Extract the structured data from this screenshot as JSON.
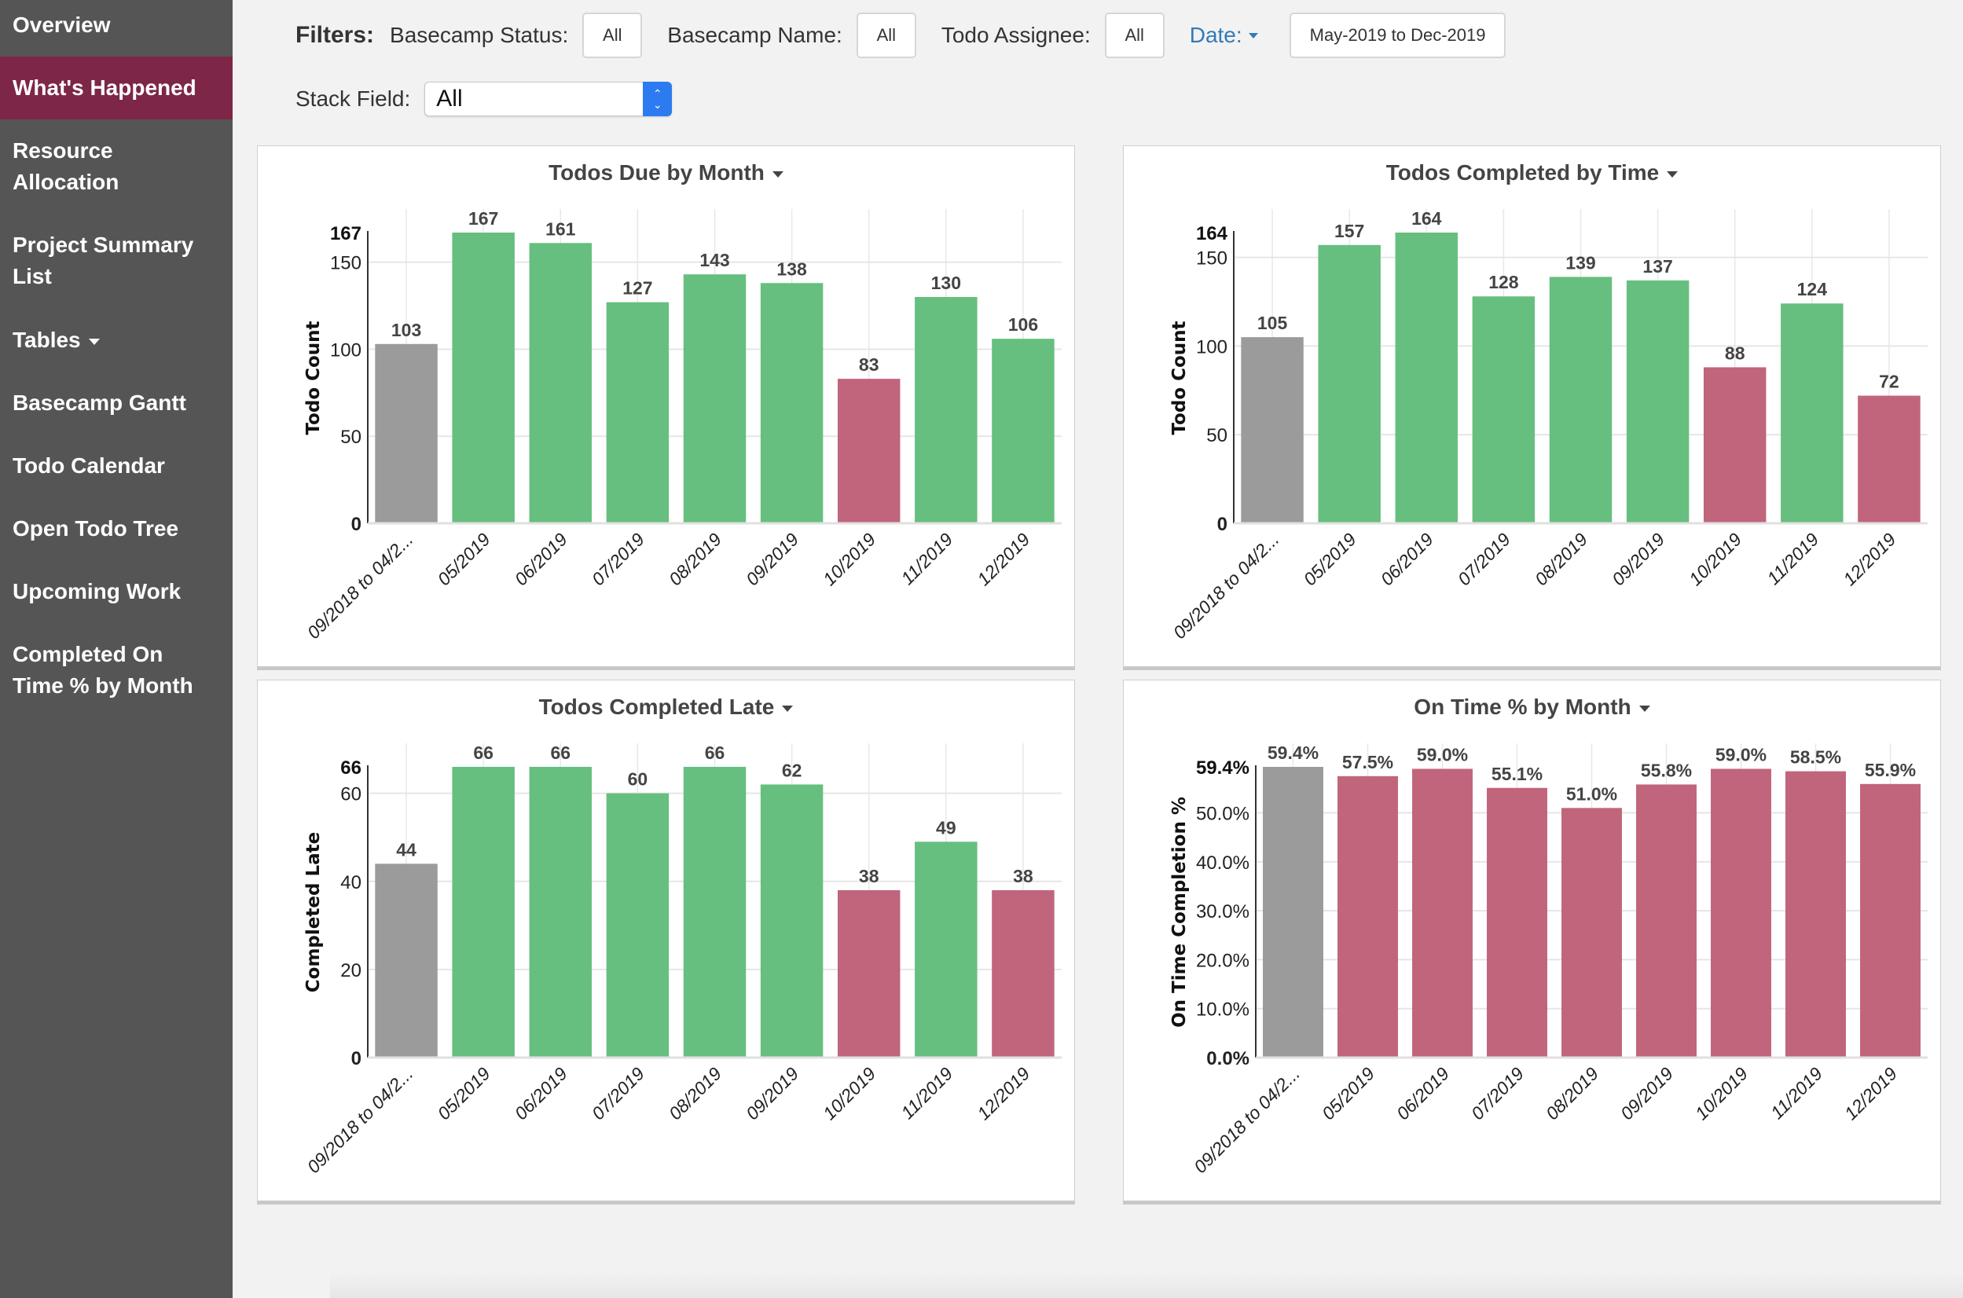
{
  "sidebar": {
    "items": [
      {
        "label": "Overview",
        "active": false
      },
      {
        "label": "What's Happened",
        "active": true
      },
      {
        "label": "Resource\nAllocation",
        "active": false
      },
      {
        "label": "Project Summary\nList",
        "active": false
      },
      {
        "label": "Tables",
        "active": false,
        "dropdown": true
      },
      {
        "label": "Basecamp Gantt",
        "active": false
      },
      {
        "label": "Todo Calendar",
        "active": false
      },
      {
        "label": "Open Todo Tree",
        "active": false
      },
      {
        "label": "Upcoming Work",
        "active": false
      },
      {
        "label": "Completed On\nTime % by Month",
        "active": false
      }
    ]
  },
  "filters": {
    "title": "Filters:",
    "basecamp_status_label": "Basecamp Status:",
    "basecamp_status_value": "All",
    "basecamp_name_label": "Basecamp Name:",
    "basecamp_name_value": "All",
    "todo_assignee_label": "Todo Assignee:",
    "todo_assignee_value": "All",
    "date_label": "Date:",
    "date_value": "May-2019 to Dec-2019",
    "stack_field_label": "Stack Field:",
    "stack_field_value": "All"
  },
  "colors": {
    "sidebar_bg": "#555555",
    "active_nav": "#7d2647",
    "green": "#66bf7f",
    "red": "#c0657c",
    "gray": "#9b9b9b",
    "link": "#337ab7"
  },
  "chart_data": [
    {
      "type": "bar",
      "title": "Todos Due by Month",
      "xlabel": "",
      "ylabel": "Todo Count",
      "categories": [
        "09/2018 to 04/2...",
        "05/2019",
        "06/2019",
        "07/2019",
        "08/2019",
        "09/2019",
        "10/2019",
        "11/2019",
        "12/2019"
      ],
      "values": [
        103,
        167,
        161,
        127,
        143,
        138,
        83,
        130,
        106
      ],
      "value_labels": [
        "103",
        "167",
        "161",
        "127",
        "143",
        "138",
        "83",
        "130",
        "106"
      ],
      "bar_colors": [
        "gray",
        "green",
        "green",
        "green",
        "green",
        "green",
        "red",
        "green",
        "green"
      ],
      "ylim": [
        0,
        167
      ],
      "yticks": [
        0,
        50,
        100,
        150
      ],
      "ytick_labels": [
        "0",
        "50",
        "100",
        "150"
      ],
      "max_label": "167",
      "grid": true,
      "legend": "none"
    },
    {
      "type": "bar",
      "title": "Todos Completed by Time",
      "xlabel": "",
      "ylabel": "Todo Count",
      "categories": [
        "09/2018 to 04/2...",
        "05/2019",
        "06/2019",
        "07/2019",
        "08/2019",
        "09/2019",
        "10/2019",
        "11/2019",
        "12/2019"
      ],
      "values": [
        105,
        157,
        164,
        128,
        139,
        137,
        88,
        124,
        72
      ],
      "value_labels": [
        "105",
        "157",
        "164",
        "128",
        "139",
        "137",
        "88",
        "124",
        "72"
      ],
      "bar_colors": [
        "gray",
        "green",
        "green",
        "green",
        "green",
        "green",
        "red",
        "green",
        "red"
      ],
      "ylim": [
        0,
        164
      ],
      "yticks": [
        0,
        50,
        100,
        150
      ],
      "ytick_labels": [
        "0",
        "50",
        "100",
        "150"
      ],
      "max_label": "164",
      "grid": true,
      "legend": "none"
    },
    {
      "type": "bar",
      "title": "Todos Completed Late",
      "xlabel": "",
      "ylabel": "Completed Late",
      "categories": [
        "09/2018 to 04/2...",
        "05/2019",
        "06/2019",
        "07/2019",
        "08/2019",
        "09/2019",
        "10/2019",
        "11/2019",
        "12/2019"
      ],
      "values": [
        44,
        66,
        66,
        60,
        66,
        62,
        38,
        49,
        38
      ],
      "value_labels": [
        "44",
        "66",
        "66",
        "60",
        "66",
        "62",
        "38",
        "49",
        "38"
      ],
      "bar_colors": [
        "gray",
        "green",
        "green",
        "green",
        "green",
        "green",
        "red",
        "green",
        "red"
      ],
      "ylim": [
        0,
        66
      ],
      "yticks": [
        0,
        20,
        40,
        60
      ],
      "ytick_labels": [
        "0",
        "20",
        "40",
        "60"
      ],
      "max_label": "66",
      "grid": true,
      "legend": "none"
    },
    {
      "type": "bar",
      "title": "On Time % by Month",
      "xlabel": "",
      "ylabel": "On Time Completion %",
      "categories": [
        "09/2018 to 04/2...",
        "05/2019",
        "06/2019",
        "07/2019",
        "08/2019",
        "09/2019",
        "10/2019",
        "11/2019",
        "12/2019"
      ],
      "values": [
        59.4,
        57.5,
        59.0,
        55.1,
        51.0,
        55.8,
        59.0,
        58.5,
        55.9
      ],
      "value_labels": [
        "59.4%",
        "57.5%",
        "59.0%",
        "55.1%",
        "51.0%",
        "55.8%",
        "59.0%",
        "58.5%",
        "55.9%"
      ],
      "bar_colors": [
        "gray",
        "red",
        "red",
        "red",
        "red",
        "red",
        "red",
        "red",
        "red"
      ],
      "ylim": [
        0,
        59.4
      ],
      "yticks": [
        0,
        10,
        20,
        30,
        40,
        50
      ],
      "ytick_labels": [
        "0.0%",
        "10.0%",
        "20.0%",
        "30.0%",
        "40.0%",
        "50.0%"
      ],
      "max_label": "59.4%",
      "grid": true,
      "legend": "none"
    }
  ]
}
